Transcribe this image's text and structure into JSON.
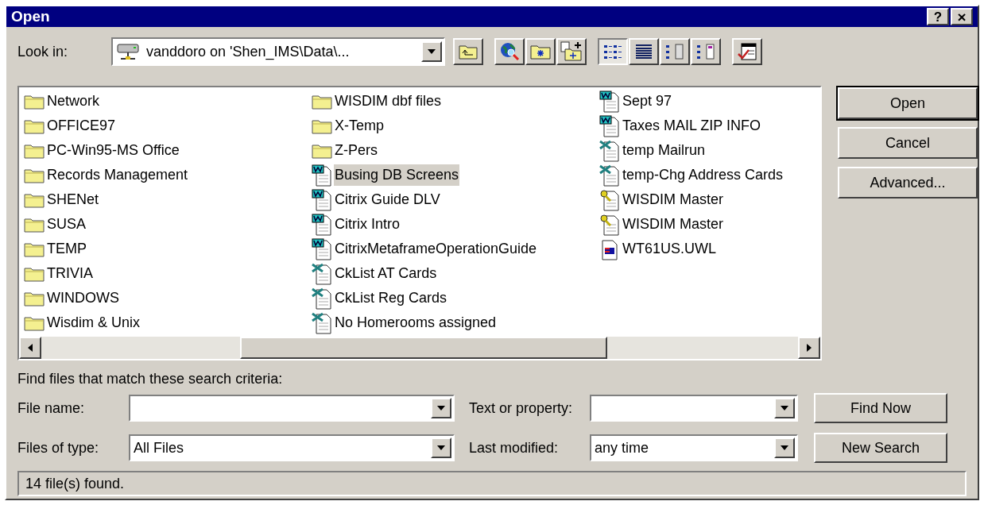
{
  "window": {
    "title": "Open",
    "help_button": "?",
    "close_button": "×"
  },
  "look_in": {
    "label": "Look in:",
    "value": "vanddoro on 'Shen_IMS\\Data\\..."
  },
  "view_buttons": [
    {
      "kind": "list",
      "selected": true
    },
    {
      "kind": "details",
      "selected": false
    },
    {
      "kind": "properties",
      "selected": false
    },
    {
      "kind": "preview",
      "selected": false
    }
  ],
  "files": [
    {
      "name": "Network",
      "kind": "folder",
      "selected": false
    },
    {
      "name": "OFFICE97",
      "kind": "folder",
      "selected": false
    },
    {
      "name": "PC-Win95-MS Office",
      "kind": "folder",
      "selected": false
    },
    {
      "name": "Records Management",
      "kind": "folder",
      "selected": false
    },
    {
      "name": "SHENet",
      "kind": "folder",
      "selected": false
    },
    {
      "name": "SUSA",
      "kind": "folder",
      "selected": false
    },
    {
      "name": "TEMP",
      "kind": "folder",
      "selected": false
    },
    {
      "name": "TRIVIA",
      "kind": "folder",
      "selected": false
    },
    {
      "name": "WINDOWS",
      "kind": "folder",
      "selected": false
    },
    {
      "name": "Wisdim & Unix",
      "kind": "folder",
      "selected": false
    },
    {
      "name": "WISDIM dbf files",
      "kind": "folder",
      "selected": false
    },
    {
      "name": "X-Temp",
      "kind": "folder",
      "selected": false
    },
    {
      "name": "Z-Pers",
      "kind": "folder",
      "selected": false
    },
    {
      "name": "Busing DB Screens",
      "kind": "word",
      "selected": true
    },
    {
      "name": "Citrix Guide DLV",
      "kind": "word",
      "selected": false
    },
    {
      "name": "Citrix Intro",
      "kind": "word",
      "selected": false
    },
    {
      "name": "CitrixMetaframeOperationGuide",
      "kind": "word",
      "selected": false
    },
    {
      "name": "CkList AT Cards",
      "kind": "excel",
      "selected": false
    },
    {
      "name": "CkList Reg Cards",
      "kind": "excel",
      "selected": false
    },
    {
      "name": "No Homerooms assigned",
      "kind": "excel",
      "selected": false
    },
    {
      "name": "Sept 97",
      "kind": "word",
      "selected": false
    },
    {
      "name": "Taxes MAIL ZIP INFO",
      "kind": "word",
      "selected": false
    },
    {
      "name": "temp Mailrun",
      "kind": "excel",
      "selected": false
    },
    {
      "name": "temp-Chg Address Cards",
      "kind": "excel",
      "selected": false
    },
    {
      "name": "WISDIM Master",
      "kind": "database-shortcut",
      "selected": false
    },
    {
      "name": "WISDIM Master",
      "kind": "database",
      "selected": false
    },
    {
      "name": "WT61US.UWL",
      "kind": "other",
      "selected": false
    }
  ],
  "buttons": [
    {
      "label": "Open",
      "default": true
    },
    {
      "label": "Cancel",
      "default": false
    },
    {
      "label": "Advanced...",
      "default": false
    }
  ],
  "search": {
    "heading": "Find files that match these search criteria:",
    "file_name": {
      "label": "File name:"
    },
    "files_of_type": {
      "label": "Files of type:",
      "value": "All Files"
    },
    "text_or_property": {
      "label": "Text or property:"
    },
    "last_modified": {
      "label": "Last modified:",
      "value": "any time"
    },
    "buttons": [
      "Find Now",
      "New Search"
    ]
  },
  "status_bar": "14 file(s) found."
}
